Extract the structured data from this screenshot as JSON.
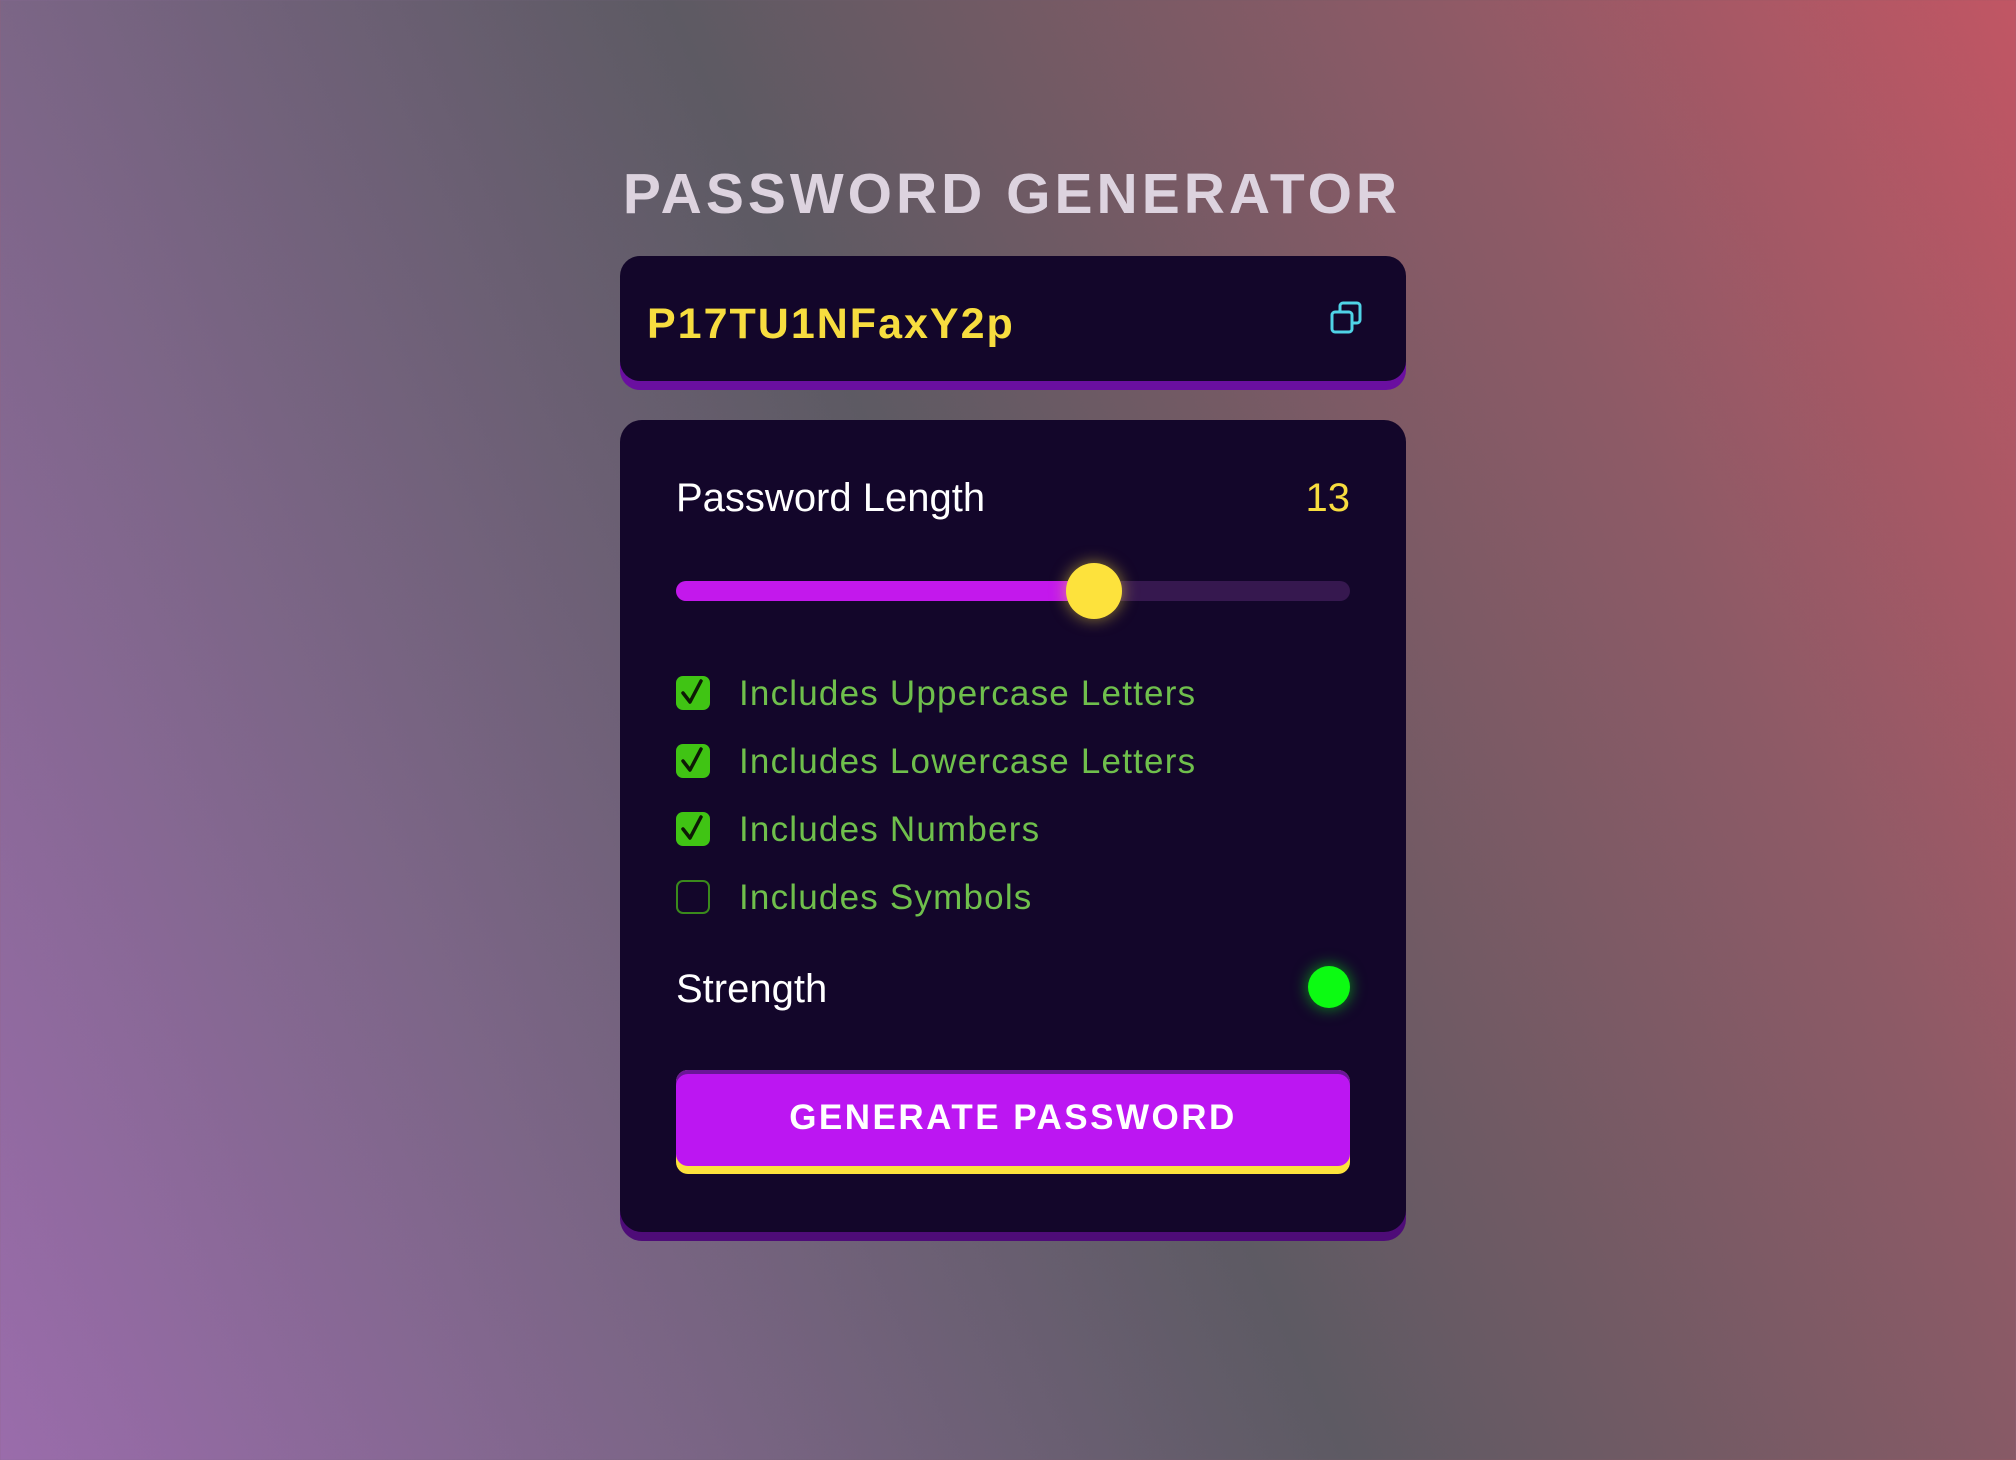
{
  "app": {
    "title": "PASSWORD GENERATOR"
  },
  "display": {
    "password": "P17TU1NFaxY2p",
    "copy_icon": "copy-icon"
  },
  "length": {
    "label": "Password Length",
    "value": "13",
    "slider_fraction": 0.62
  },
  "options": [
    {
      "label": "Includes Uppercase Letters",
      "checked": true
    },
    {
      "label": "Includes Lowercase Letters",
      "checked": true
    },
    {
      "label": "Includes Numbers",
      "checked": true
    },
    {
      "label": "Includes Symbols",
      "checked": false
    }
  ],
  "strength": {
    "label": "Strength",
    "indicator_color": "#0cfb12"
  },
  "generate": {
    "label": "GENERATE PASSWORD"
  },
  "colors": {
    "accent_purple": "#bc16f2",
    "accent_yellow": "#fde23c",
    "option_green": "#6fbf4c",
    "checkbox_green": "#40c414",
    "panel_bg": "#13062a"
  }
}
